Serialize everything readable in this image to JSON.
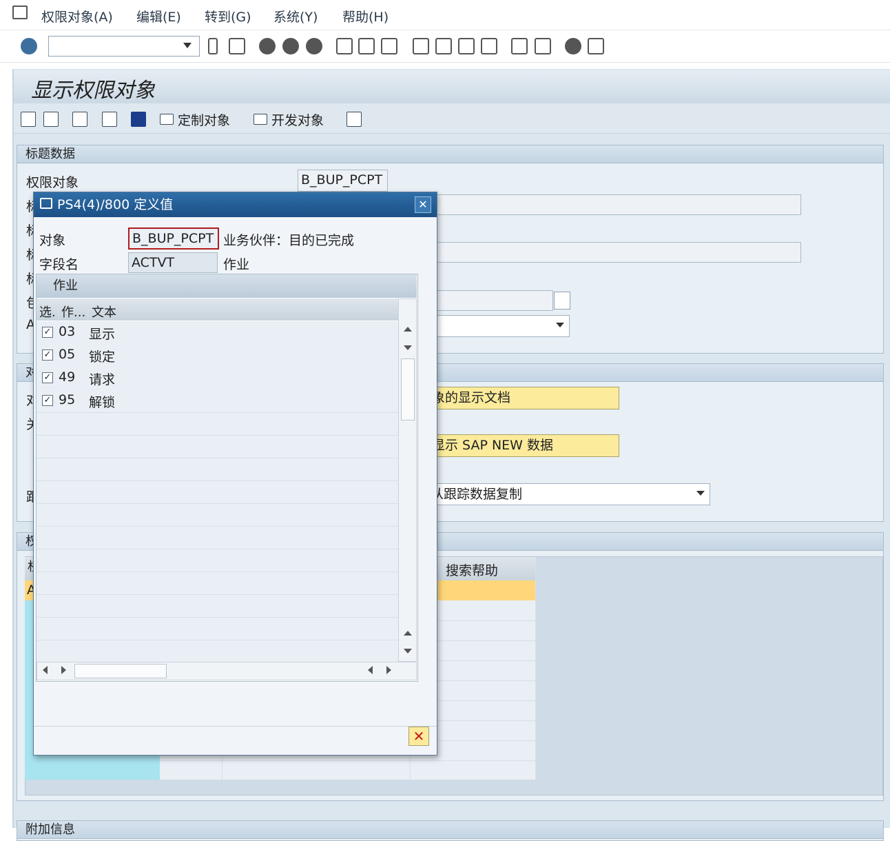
{
  "menu": {
    "items": [
      "权限对象(A)",
      "编辑(E)",
      "转到(G)",
      "系统(Y)",
      "帮助(H)"
    ]
  },
  "toolbar": {
    "command_value": "",
    "icons": [
      "enter-icon",
      "back-icon",
      "save-icon",
      "back-nav-icon",
      "exit-icon",
      "cancel-icon",
      "print-icon",
      "find-icon",
      "find-next-icon",
      "first-page-icon",
      "prev-page-icon",
      "next-page-icon",
      "last-page-icon",
      "new-session-icon",
      "shortcut-icon",
      "help-icon",
      "layout-icon"
    ]
  },
  "page": {
    "title": "显示权限对象"
  },
  "app_toolbar": {
    "custom_object": "定制对象",
    "dev_object": "开发对象"
  },
  "header_group": {
    "title": "标题数据",
    "auth_object_label": "权限对象",
    "auth_object_value": "B_BUP_PCPT",
    "partial_label_1": "标",
    "partial_label_2": "标",
    "partial_label_3": "标",
    "partial_label_4": "标",
    "partial_label_5": "包",
    "partial_label_6": "A"
  },
  "second_group": {
    "title_partial": "对",
    "row1_partial": "对",
    "row2_partial": "关",
    "row3_partial": "跟",
    "doc_button": "象的显示文档",
    "sapnew_button": "显示 SAP NEW 数据",
    "copy_dropdown": "从跟踪数据复制"
  },
  "third_group": {
    "title_partial": "权",
    "col_partial": "权",
    "cell_partial": "A",
    "search_help_header": "搜索帮助"
  },
  "footer_group": {
    "title_partial": "附加信息"
  },
  "dialog": {
    "title": "PS4(4)/800 定义值",
    "object_label": "对象",
    "object_value": "B_BUP_PCPT",
    "object_desc": "业务伙伴：目的已完成",
    "field_label": "字段名",
    "field_value": "ACTVT",
    "field_desc": "作业",
    "table_title": "作业",
    "columns": [
      "选.",
      "作...",
      "文本"
    ],
    "rows": [
      {
        "checked": true,
        "code": "03",
        "text": "显示"
      },
      {
        "checked": true,
        "code": "05",
        "text": "锁定"
      },
      {
        "checked": true,
        "code": "49",
        "text": "请求"
      },
      {
        "checked": true,
        "code": "95",
        "text": "解锁"
      }
    ]
  }
}
